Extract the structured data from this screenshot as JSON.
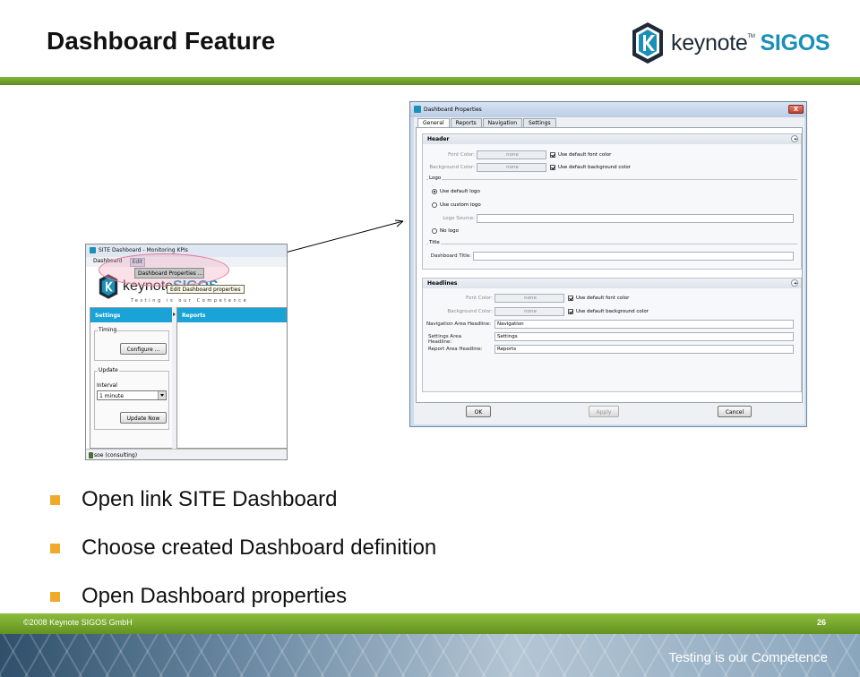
{
  "slide": {
    "title": "Dashboard Feature",
    "brand": {
      "name": "keynote",
      "tm": "TM",
      "suffix": "SIGOS"
    },
    "bullets": [
      "Open link SITE Dashboard",
      "Choose created Dashboard definition",
      "Open Dashboard properties"
    ],
    "copyright": "©2008 Keynote SIGOS GmbH",
    "page_number": "26",
    "tagline": "Testing is our Competence",
    "colors": {
      "accent_green": "#7aad33",
      "bullet_orange": "#f0a92b",
      "panel_blue": "#1aa3d6"
    }
  },
  "site_dashboard": {
    "window_title": "SITE Dashboard - Monitoring KPIs",
    "menu": [
      "Dashboard",
      "Edit"
    ],
    "dropdown_item": "Dashboard Properties ...",
    "tooltip": "Edit Dashboard properties",
    "logo_sub": "Testing is our Competence",
    "logo_name": "keynote",
    "logo_suffix": "SIGOS",
    "settings_header": "Settings",
    "reports_header": "Reports",
    "timing_label": "Timing",
    "configure_button": "Configure ...",
    "update_label": "Update",
    "interval_label": "Interval",
    "interval_value": "1 minute",
    "update_now_button": "Update Now",
    "status_text": "soe (consulting)"
  },
  "dialog": {
    "title": "Dashboard Properties",
    "close_glyph": "X",
    "tabs": [
      "General",
      "Reports",
      "Navigation",
      "Settings"
    ],
    "header_section": {
      "title": "Header",
      "font_color_label": "Font Color:",
      "font_color_value": "none",
      "font_color_checkbox": "Use default font color",
      "bg_color_label": "Background Color:",
      "bg_color_value": "none",
      "bg_color_checkbox": "Use default background color",
      "logo_group": "Logo",
      "logo_options": [
        "Use default logo",
        "Use custom logo"
      ],
      "logo_source_label": "Logo Source:",
      "logo_source_value": "",
      "no_logo": "No logo",
      "title_group": "Title",
      "dashboard_title_label": "Dashboard Title:",
      "dashboard_title_value": ""
    },
    "headlines_section": {
      "title": "Headlines",
      "font_color_label": "Font Color:",
      "font_color_value": "none",
      "font_color_checkbox": "Use default font color",
      "bg_color_label": "Background Color:",
      "bg_color_value": "none",
      "bg_color_checkbox": "Use default background color",
      "nav_label": "Navigation Area Headline:",
      "nav_value": "Navigation",
      "settings_label": "Settings Area Headline:",
      "settings_value": "Settings",
      "report_label": "Report Area Headline:",
      "report_value": "Reports"
    },
    "buttons": {
      "ok": "OK",
      "apply": "Apply",
      "cancel": "Cancel"
    }
  }
}
